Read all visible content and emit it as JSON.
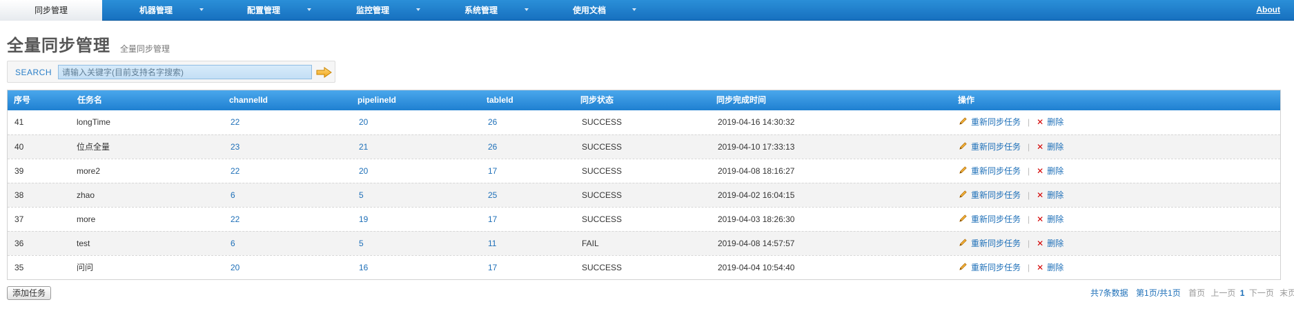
{
  "nav": {
    "items": [
      {
        "label": "同步管理",
        "active": true
      },
      {
        "label": "机器管理",
        "active": false
      },
      {
        "label": "配置管理",
        "active": false
      },
      {
        "label": "监控管理",
        "active": false
      },
      {
        "label": "系统管理",
        "active": false
      },
      {
        "label": "使用文档",
        "active": false
      }
    ],
    "about": "About"
  },
  "page": {
    "title": "全量同步管理",
    "subtitle": "全量同步管理"
  },
  "search": {
    "label": "SEARCH",
    "placeholder": "请输入关键字(目前支持名字搜索)",
    "go_icon": "arrow-right-icon"
  },
  "table": {
    "columns": [
      "序号",
      "任务名",
      "channelId",
      "pipelineId",
      "tableId",
      "同步状态",
      "同步完成时间",
      "操作"
    ],
    "rows": [
      {
        "id": "41",
        "name": "longTime",
        "channelId": "22",
        "pipelineId": "20",
        "tableId": "26",
        "status": "SUCCESS",
        "time": "2019-04-16 14:30:32"
      },
      {
        "id": "40",
        "name": "位点全量",
        "channelId": "23",
        "pipelineId": "21",
        "tableId": "26",
        "status": "SUCCESS",
        "time": "2019-04-10 17:33:13"
      },
      {
        "id": "39",
        "name": "more2",
        "channelId": "22",
        "pipelineId": "20",
        "tableId": "17",
        "status": "SUCCESS",
        "time": "2019-04-08 18:16:27"
      },
      {
        "id": "38",
        "name": "zhao",
        "channelId": "6",
        "pipelineId": "5",
        "tableId": "25",
        "status": "SUCCESS",
        "time": "2019-04-02 16:04:15"
      },
      {
        "id": "37",
        "name": "more",
        "channelId": "22",
        "pipelineId": "19",
        "tableId": "17",
        "status": "SUCCESS",
        "time": "2019-04-03 18:26:30"
      },
      {
        "id": "36",
        "name": "test",
        "channelId": "6",
        "pipelineId": "5",
        "tableId": "11",
        "status": "FAIL",
        "time": "2019-04-08 14:57:57"
      },
      {
        "id": "35",
        "name": "问问",
        "channelId": "20",
        "pipelineId": "16",
        "tableId": "17",
        "status": "SUCCESS",
        "time": "2019-04-04 10:54:40"
      }
    ],
    "ops": {
      "redo": "重新同步任务",
      "separator": "|",
      "delete_mark": "✕",
      "delete": "删除"
    }
  },
  "footer": {
    "add_button": "添加任务",
    "total": "共7条数据",
    "page_info": "第1页/共1页",
    "first": "首页",
    "prev": "上一页",
    "current": "1",
    "next": "下一页",
    "last": "末页"
  },
  "colors": {
    "nav_blue": "#1770bf",
    "header_blue": "#1f80d1",
    "link_blue": "#1d6fb8",
    "delete_red": "#d40000"
  }
}
